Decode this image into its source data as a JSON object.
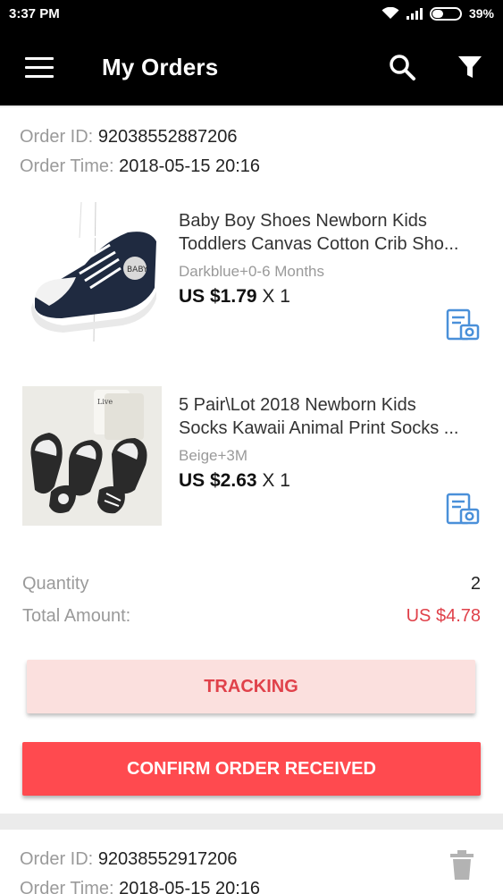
{
  "status_bar": {
    "time": "3:37 PM",
    "battery_text": "39%",
    "battery_level": 0.39
  },
  "header": {
    "title": "My Orders"
  },
  "labels": {
    "order_id": "Order ID:",
    "order_time": "Order Time:",
    "quantity": "Quantity",
    "total_amount": "Total Amount:"
  },
  "orders": [
    {
      "id": "92038552887206",
      "time": "2018-05-15 20:16",
      "products": [
        {
          "title_line1": "Baby Boy Shoes Newborn Kids",
          "title_line2": "Toddlers Canvas Cotton Crib Sho...",
          "variant": "Darkblue+0-6 Months",
          "price": "US $1.79",
          "qty": "X 1"
        },
        {
          "title_line1": "5 Pair\\Lot 2018 Newborn Kids",
          "title_line2": "Socks Kawaii Animal Print Socks ...",
          "variant": "Beige+3M",
          "price": "US $2.63",
          "qty": "X 1"
        }
      ],
      "quantity": "2",
      "total": "US $4.78",
      "tracking_label": "TRACKING",
      "confirm_label": "CONFIRM ORDER RECEIVED"
    },
    {
      "id": "92038552917206",
      "time": "2018-05-15 20:16"
    }
  ],
  "colors": {
    "accent_red": "#ff4a4f",
    "price_red": "#e0414a",
    "tracking_bg": "#fbe0de",
    "icon_blue": "#4a90d9"
  },
  "icons": [
    "menu-icon",
    "search-icon",
    "filter-icon",
    "snapshot-icon",
    "trash-icon",
    "wifi-icon",
    "signal-icon",
    "battery-icon"
  ]
}
